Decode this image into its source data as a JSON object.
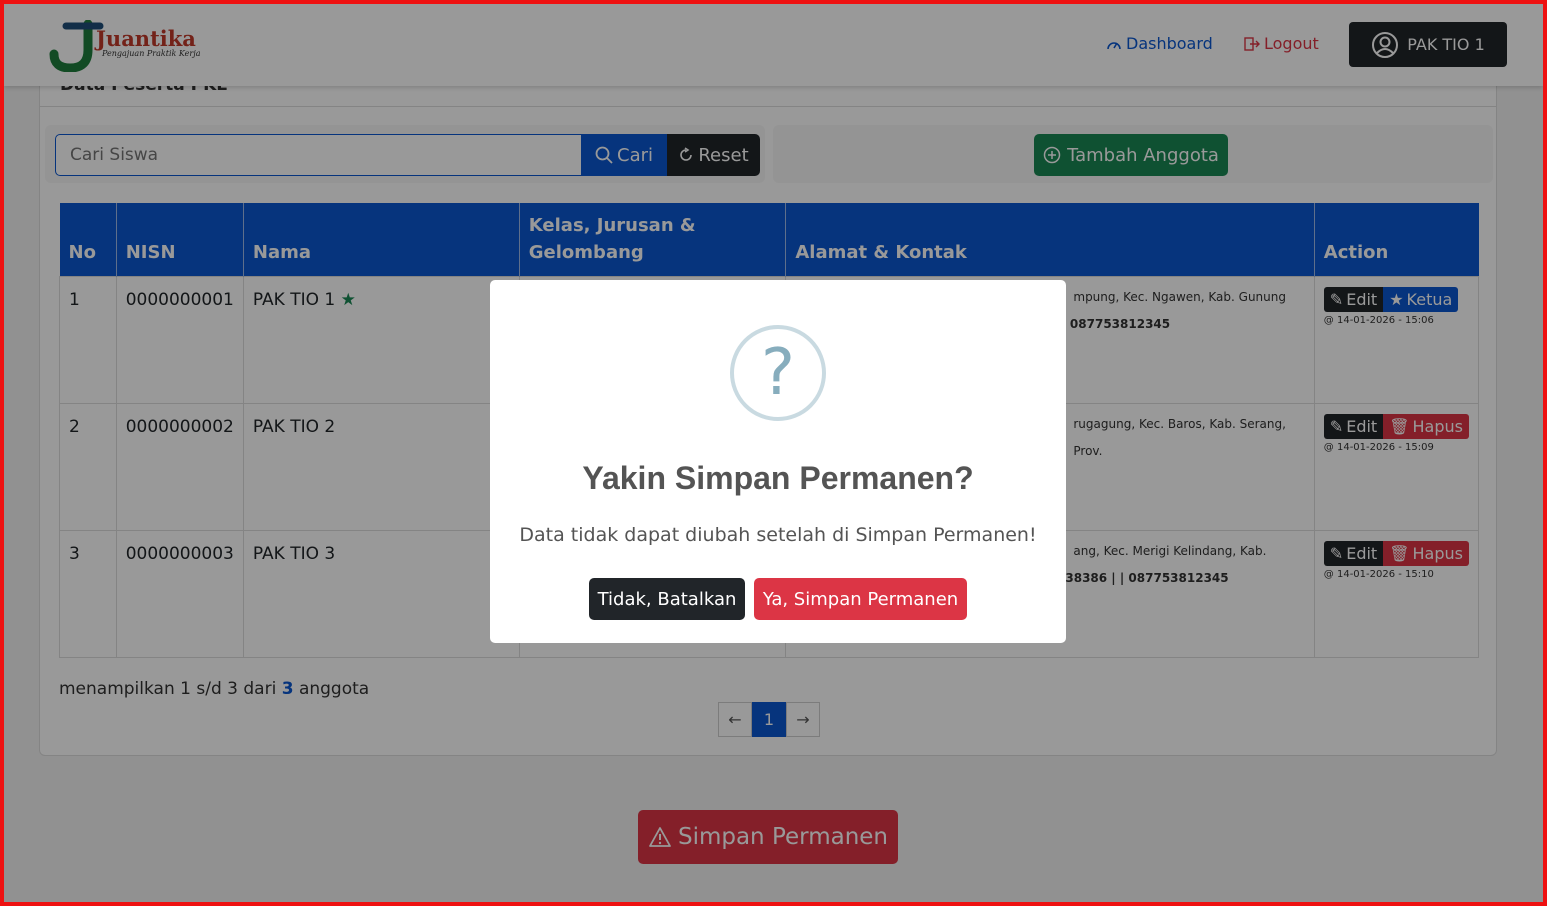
{
  "brand": {
    "name": "Juantika",
    "tagline": "Pengajuan Praktik Kerja"
  },
  "nav": {
    "dashboard": "Dashboard",
    "logout": "Logout",
    "user": "PAK TIO 1"
  },
  "card": {
    "title": "Data Peserta PKL"
  },
  "search": {
    "placeholder": "Cari Siswa",
    "cari": "Cari",
    "reset": "Reset"
  },
  "add_label": "Tambah Anggota",
  "table": {
    "headers": [
      "No",
      "NISN",
      "Nama",
      "Kelas, Jurusan & Gelombang",
      "Alamat & Kontak",
      "Action"
    ],
    "rows": [
      {
        "no": "1",
        "nisn": "0000000001",
        "nama": "PAK TIO 1",
        "addr1": "mpung, Kec. Ngawen, Kab. Gunung",
        "addr2": "| 087753812345",
        "btn2": "Ketua",
        "stamp": "@ 14-01-2026 - 15:06"
      },
      {
        "no": "2",
        "nisn": "0000000002",
        "nama": "PAK TIO 2",
        "addr1": "rugagung, Kec. Baros, Kab. Serang, Prov.",
        "addr2": "",
        "btn2": "Hapus",
        "stamp": "@ 14-01-2026 - 15:09"
      },
      {
        "no": "3",
        "nisn": "0000000003",
        "nama": "PAK TIO 3",
        "addr1": "ang, Kec. Merigi Kelindang, Kab.",
        "addr2": "38386 | | 087753812345",
        "btn2": "Hapus",
        "stamp": "@ 14-01-2026 - 15:10"
      }
    ],
    "edit_label": "Edit"
  },
  "summary": {
    "prefix": "menampilkan 1 s/d 3 dari",
    "count": "3",
    "suffix": "anggota"
  },
  "pager": {
    "prev": "←",
    "page": "1",
    "next": "→"
  },
  "save_button": "Simpan Permanen",
  "modal": {
    "icon": "?",
    "title": "Yakin Simpan Permanen?",
    "text": "Data tidak dapat diubah setelah di Simpan Permanen!",
    "cancel": "Tidak, Batalkan",
    "confirm": "Ya, Simpan Permanen"
  },
  "colors": {
    "primary": "#0b57d0",
    "danger": "#dc3545",
    "success": "#198754",
    "dark": "#212529"
  }
}
